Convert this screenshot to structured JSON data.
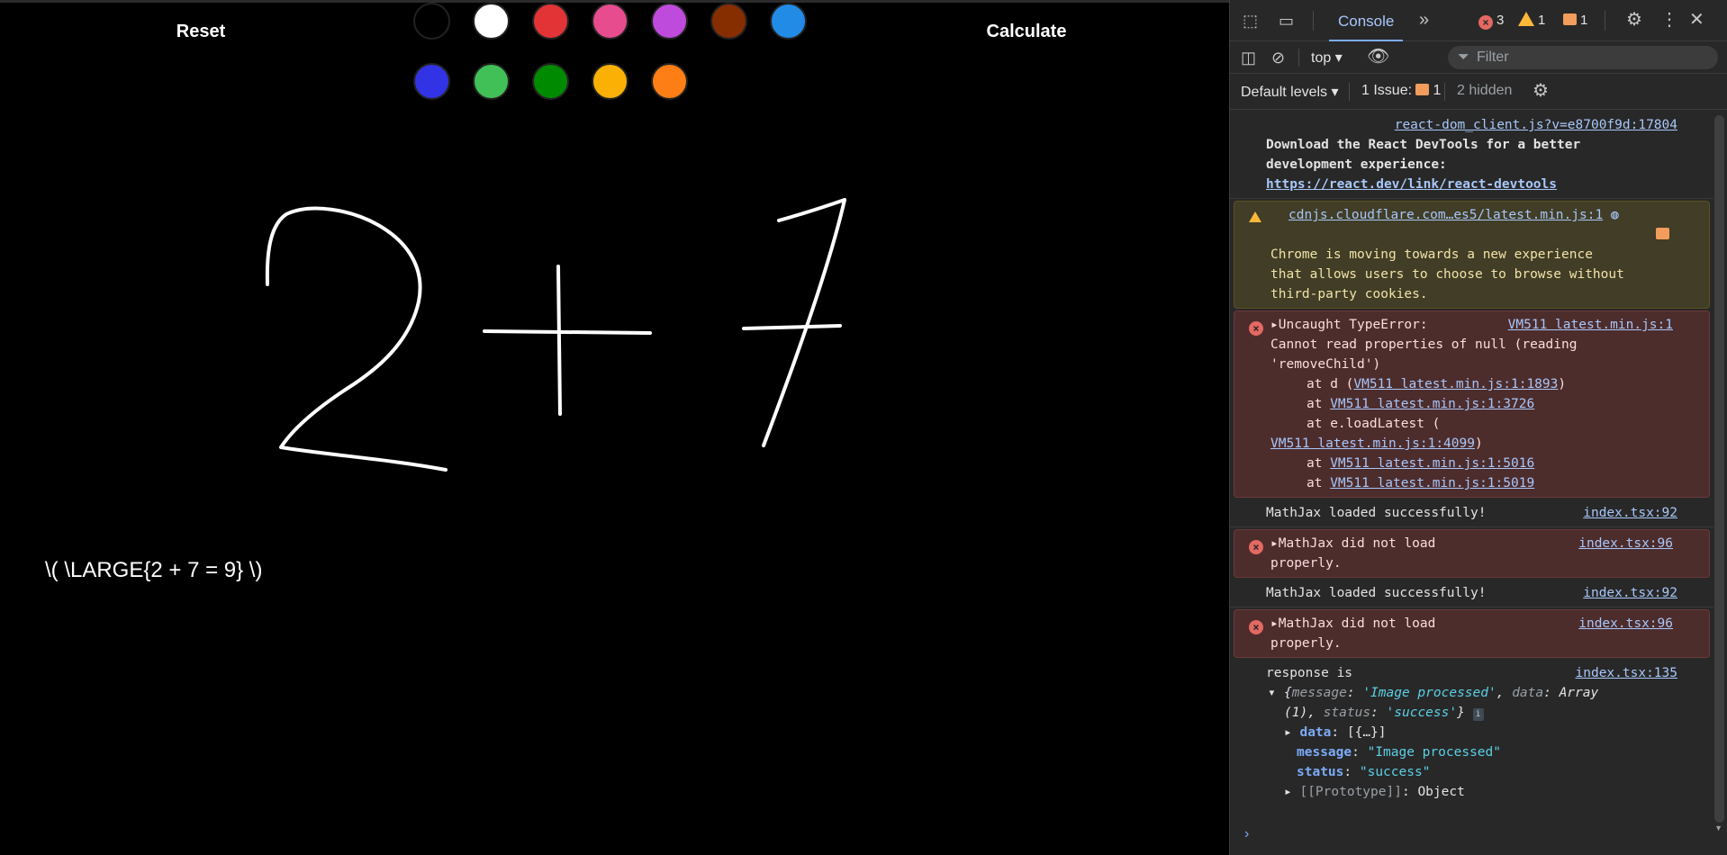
{
  "app": {
    "reset_label": "Reset",
    "calculate_label": "Calculate",
    "swatches": [
      {
        "name": "black",
        "color": "#000000"
      },
      {
        "name": "white",
        "color": "#ffffff"
      },
      {
        "name": "red",
        "color": "#e23437"
      },
      {
        "name": "pink",
        "color": "#e64c8e"
      },
      {
        "name": "purple",
        "color": "#be4bdb"
      },
      {
        "name": "brown",
        "color": "#862e00"
      },
      {
        "name": "blue",
        "color": "#228be6"
      },
      {
        "name": "indigo",
        "color": "#3333e6"
      },
      {
        "name": "green",
        "color": "#40c057"
      },
      {
        "name": "dark-green",
        "color": "#008a00"
      },
      {
        "name": "yellow",
        "color": "#fab005"
      },
      {
        "name": "orange",
        "color": "#fd7e14"
      }
    ],
    "drawing_stroke_color": "#ffffff",
    "latex_result": "\\( \\LARGE{2 + 7 = 9} \\)"
  },
  "devtools": {
    "tab_console": "Console",
    "more_tabs_icon": "chevron-double-right",
    "errors_count": "3",
    "warnings_count": "1",
    "issues_count": "1",
    "context": "top",
    "filter_placeholder": "Filter",
    "levels": "Default levels",
    "issues_label": "1 Issue:",
    "issues_badge": "1",
    "hidden_label": "2 hidden",
    "messages": {
      "m1_src": "react-dom_client.js?v=e8700f9d:17804",
      "m1_line1": "Download the React DevTools for a better",
      "m1_line2": "development experience:",
      "m1_link": "https://react.dev/link/react-devtools",
      "m2_src": "cdnjs.cloudflare.com…es5/latest.min.js:1",
      "m2_line1": "Chrome is moving towards a new experience",
      "m2_line2": "that allows users to choose to browse without",
      "m2_line3": "third-party cookies.",
      "m3_head": "Uncaught TypeError:",
      "m3_src": "VM511 latest.min.js:1",
      "m3_line1": "Cannot read properties of null (reading",
      "m3_line2": "'removeChild')",
      "m3_at1_pre": "at d (",
      "m3_at1_link": "VM511 latest.min.js:1:1893",
      "m3_at1_post": ")",
      "m3_at2_pre": "at ",
      "m3_at2_link": "VM511 latest.min.js:1:3726",
      "m3_at3_pre": "at e.loadLatest (",
      "m3_at3_link": "VM511 latest.min.js:1:4099",
      "m3_at3_post": ")",
      "m3_at4_pre": "at ",
      "m3_at4_link": "VM511 latest.min.js:1:5016",
      "m3_at5_pre": "at ",
      "m3_at5_link": "VM511 latest.min.js:1:5019",
      "m4_text": "MathJax loaded successfully!",
      "m4_src": "index.tsx:92",
      "m5_line1": "MathJax did not load",
      "m5_line2": "properly.",
      "m5_src": "index.tsx:96",
      "m6_text": "MathJax loaded successfully!",
      "m6_src": "index.tsx:92",
      "m7_line1": "MathJax did not load",
      "m7_line2": "properly.",
      "m7_src": "index.tsx:96",
      "m8_text": "response is",
      "m8_src": "index.tsx:135",
      "m8_obj_open": "{",
      "m8_k1": "message",
      "m8_v1": "'Image processed'",
      "m8_k2": "data",
      "m8_v2": "Array",
      "m8_v2b": "(1)",
      "m8_k3": "status",
      "m8_v3": "'success'",
      "m8_obj_close": "}",
      "m8_data_key": "data",
      "m8_data_val": "[{…}]",
      "m8_msg_key": "message",
      "m8_msg_val": "\"Image processed\"",
      "m8_status_key": "status",
      "m8_status_val": "\"success\"",
      "m8_proto_key": "[[Prototype]]",
      "m8_proto_val": "Object"
    }
  }
}
